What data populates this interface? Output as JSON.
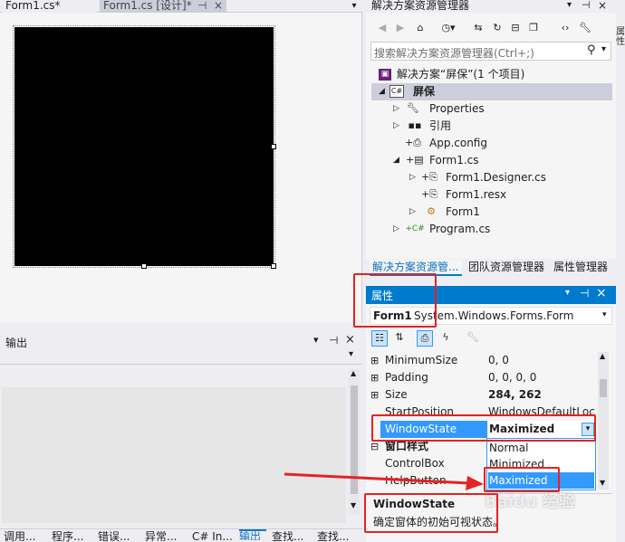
{
  "doc_tabs": [
    {
      "label": "Form1.cs*"
    },
    {
      "label": "Form1.cs [设计]*"
    }
  ],
  "doc_tab_pin": "⊣",
  "doc_tab_close": "×",
  "output_panel": {
    "title": "输出",
    "pin": "⊣",
    "close": "×",
    "arrow": "▾"
  },
  "solution_explorer": {
    "title": "解决方案资源管理器",
    "search_placeholder": "搜索解决方案资源管理器(Ctrl+;)",
    "tree": [
      {
        "label": "解决方案“屏保”(1 个项目)",
        "icon": "solution-icon"
      },
      {
        "label": "屏保",
        "icon": "csharp-project-icon"
      },
      {
        "label": "Properties",
        "icon": "wrench-icon"
      },
      {
        "label": "引用",
        "icon": "references-icon"
      },
      {
        "label": "App.config",
        "icon": "config-icon"
      },
      {
        "label": "Form1.cs",
        "icon": "form-icon"
      },
      {
        "label": "Form1.Designer.cs",
        "icon": "cs-file-icon"
      },
      {
        "label": "Form1.resx",
        "icon": "resx-icon"
      },
      {
        "label": "Form1",
        "icon": "class-icon"
      },
      {
        "label": "Program.cs",
        "icon": "csharp-file-icon"
      }
    ],
    "bottom_tabs": [
      {
        "label": "解决方案资源管..."
      },
      {
        "label": "团队资源管理器"
      },
      {
        "label": "属性管理器"
      }
    ]
  },
  "properties": {
    "title": "属性",
    "object_name": "Form1",
    "object_type": "System.Windows.Forms.Form",
    "rows": [
      {
        "name": "MinimumSize",
        "value": "0, 0",
        "expand": "⊞"
      },
      {
        "name": "Padding",
        "value": "0, 0, 0, 0",
        "expand": "⊞"
      },
      {
        "name": "Size",
        "value": "284, 262",
        "expand": "⊞"
      },
      {
        "name": "StartPosition",
        "value": "WindowsDefaultLoc",
        "expand": ""
      },
      {
        "name": "WindowState",
        "value": "Maximized",
        "expand": ""
      }
    ],
    "category": {
      "label": "窗口样式",
      "expand": "⊟"
    },
    "rows2": [
      {
        "name": "ControlBox",
        "value": ""
      },
      {
        "name": "HelpButton",
        "value": ""
      }
    ],
    "dropdown_options": [
      "Normal",
      "Minimized",
      "Maximized"
    ],
    "description_title": "WindowState",
    "description_text": "确定窗体的初始可视状态。"
  },
  "right_edge_label": "属性",
  "bottom_tabs": [
    {
      "label": "调用..."
    },
    {
      "label": "程序..."
    },
    {
      "label": "错误..."
    },
    {
      "label": "异常..."
    },
    {
      "label": "C# In..."
    },
    {
      "label": "输出"
    },
    {
      "label": "查找..."
    },
    {
      "label": "查找..."
    }
  ],
  "watermark": "Baidu 经验",
  "colors": {
    "accent": "#007acc",
    "highlight": "#3399ff",
    "annotation": "#e52222"
  }
}
